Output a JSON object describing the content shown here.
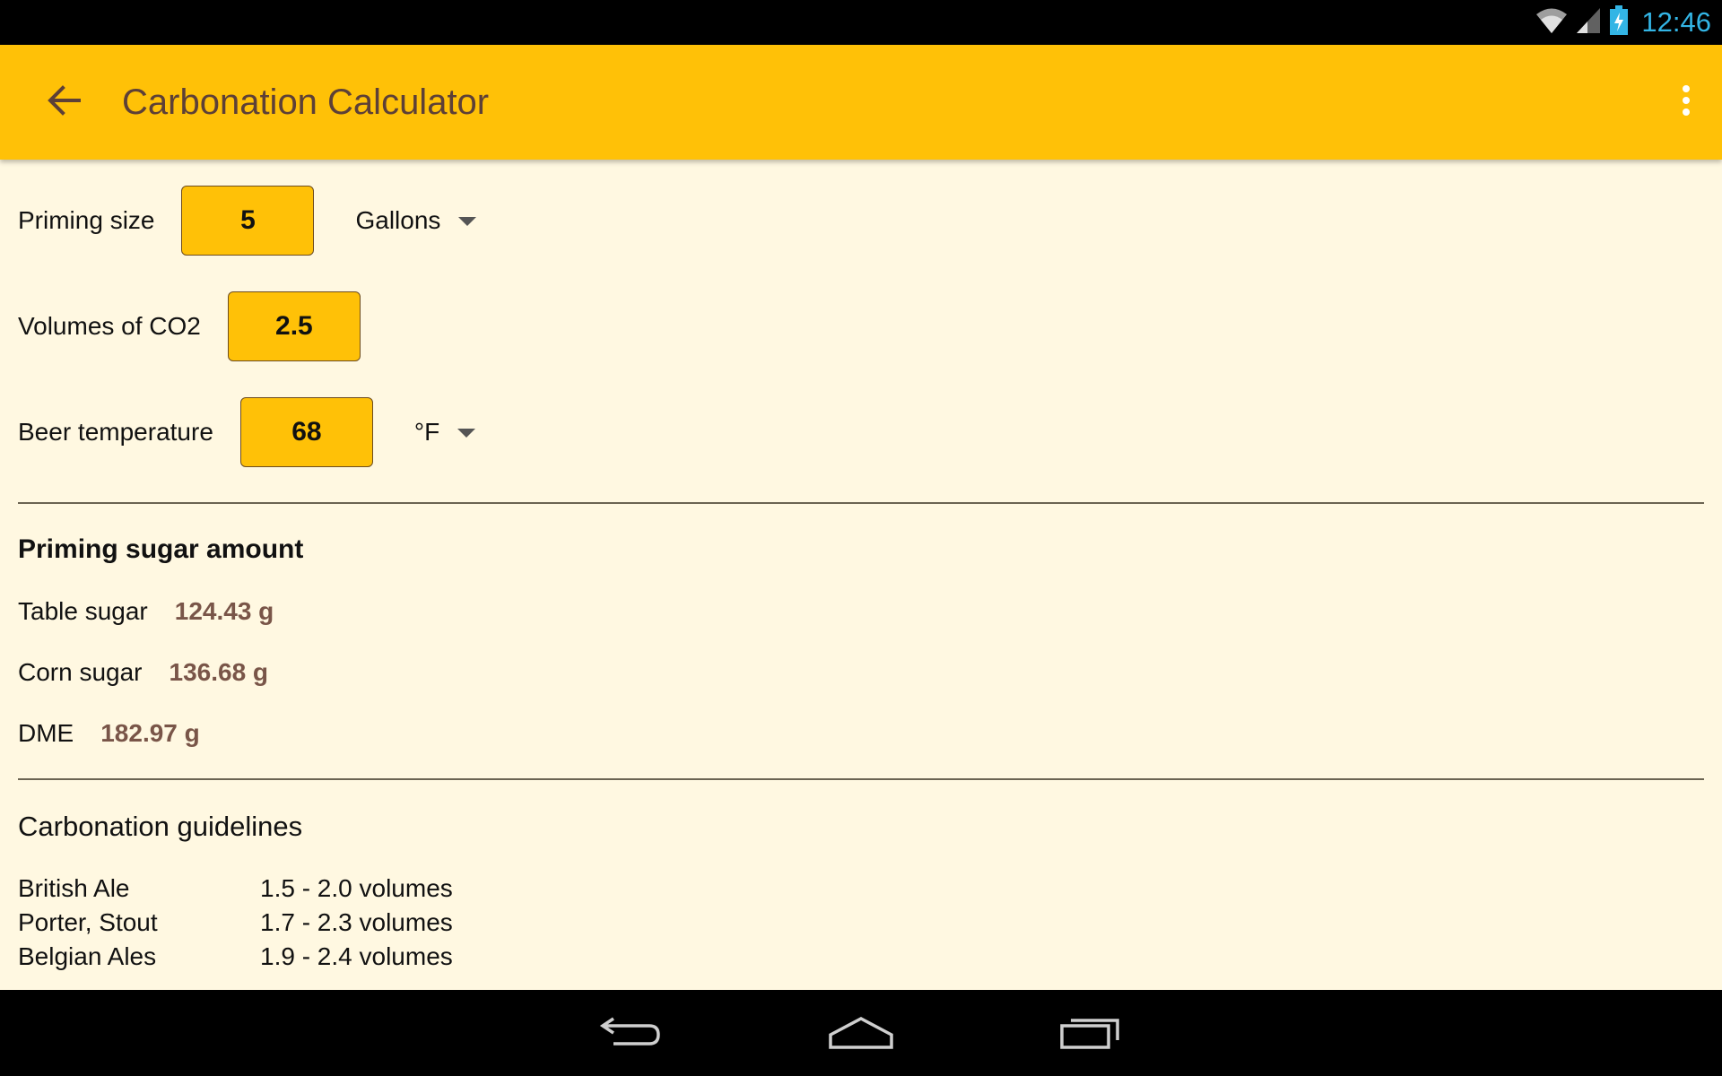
{
  "status_bar": {
    "time": "12:46",
    "icons": [
      "wifi-icon",
      "signal-icon",
      "battery-charging-icon"
    ],
    "time_color": "#33B5E5"
  },
  "app_bar": {
    "title": "Carbonation Calculator",
    "back_icon": "arrow-back-icon",
    "overflow_icon": "more-vert-icon",
    "color": "#FFC107"
  },
  "inputs": {
    "priming_size": {
      "label": "Priming size",
      "value": "5",
      "unit": "Gallons"
    },
    "co2_volumes": {
      "label": "Volumes of CO2",
      "value": "2.5"
    },
    "beer_temperature": {
      "label": "Beer temperature",
      "value": "68",
      "unit": "°F"
    }
  },
  "results": {
    "title": "Priming sugar amount",
    "items": [
      {
        "label": "Table sugar",
        "value": "124.43 g"
      },
      {
        "label": "Corn sugar",
        "value": "136.68 g"
      },
      {
        "label": "DME",
        "value": "182.97 g"
      }
    ],
    "value_color": "#795548"
  },
  "guidelines": {
    "title": "Carbonation guidelines",
    "items": [
      {
        "style": "British Ale",
        "range": "1.5 - 2.0 volumes"
      },
      {
        "style": "Porter, Stout",
        "range": "1.7 - 2.3 volumes"
      },
      {
        "style": "Belgian Ales",
        "range": "1.9 - 2.4 volumes"
      }
    ]
  },
  "nav_bar": {
    "icons": [
      "nav-back-icon",
      "nav-home-icon",
      "nav-recents-icon"
    ]
  }
}
